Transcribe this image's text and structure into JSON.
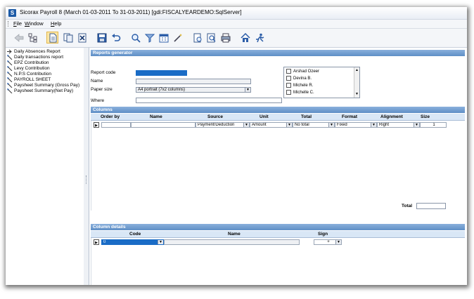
{
  "window": {
    "title": "Sicorax Payroll 8 (March 01-03-2011 To 31-03-2011) [gdi:FISCALYEARDEMO:SqlServer]",
    "app_icon": "S"
  },
  "menu": {
    "file": "File",
    "window": "Window",
    "help": "Help"
  },
  "toolbar_icons": [
    "back-arrow-icon",
    "tree-icon",
    "report-page-icon",
    "copy-page-icon",
    "delete-page-icon",
    "save-disk-icon",
    "undo-icon",
    "search-magnifier-icon",
    "funnel-filter-icon",
    "calendar-icon",
    "wand-icon",
    "print-preview-icon",
    "zoom-page-icon",
    "printer-icon",
    "home-icon",
    "run-icon"
  ],
  "sidebar": {
    "items": [
      {
        "label": "Daily Absences Report"
      },
      {
        "label": "Daily transactions report"
      },
      {
        "label": "EPZ Contribution"
      },
      {
        "label": "Levy Contribution"
      },
      {
        "label": "N.P.S Contribution"
      },
      {
        "label": "PAYROLL SHEET"
      },
      {
        "label": "Paysheet Summary (Gross Pay)"
      },
      {
        "label": "Paysheet Summary(Net Pay)"
      }
    ]
  },
  "generator": {
    "header": "Reports generator",
    "report_code_label": "Report code",
    "name_label": "Name",
    "paper_size_label": "Paper size",
    "paper_size_value": "A4 portrait (7x2 columns)",
    "where_label": "Where",
    "employees": [
      "Arshad Ozeer",
      "Devina B.",
      "Michele R.",
      "Michelle C."
    ]
  },
  "columns": {
    "header": "Columns",
    "headings": [
      "Order by",
      "Name",
      "Source",
      "Unit",
      "Total",
      "Format",
      "Alignment",
      "Size"
    ],
    "row": {
      "source": "Payment/Deduction",
      "unit": "Amount",
      "total": "No total",
      "format": "Fixed",
      "alignment": "Right",
      "size": "1"
    },
    "total_label": "Total"
  },
  "column_details": {
    "header": "Column details",
    "headings": [
      "Code",
      "Name",
      "Sign"
    ],
    "row": {
      "code": "0",
      "sign": "+"
    }
  }
}
